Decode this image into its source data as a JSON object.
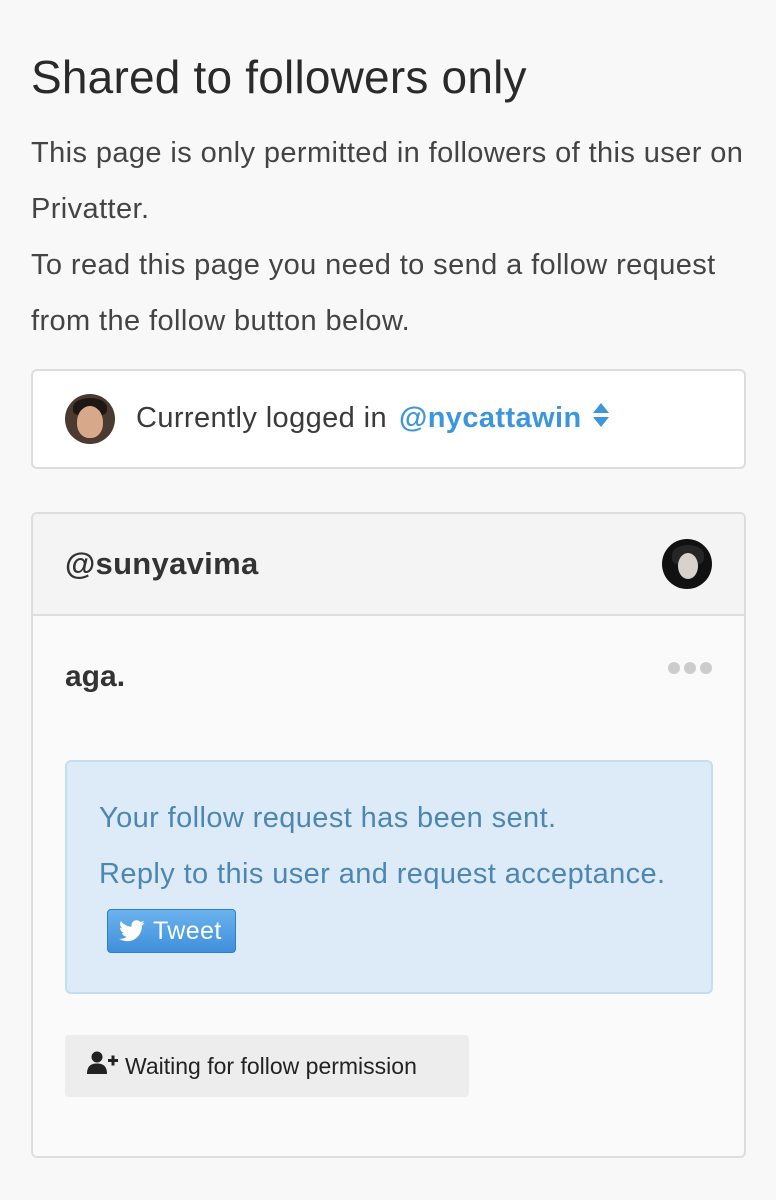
{
  "page": {
    "title": "Shared to followers only",
    "intro_line1": "This page is only permitted in followers of this user on Privatter.",
    "intro_line2": "To read this page you need to send a follow request from the follow button below."
  },
  "login": {
    "label": "Currently logged in",
    "username": "@nycattawin",
    "switch_icon": "sort-updown-icon"
  },
  "card": {
    "owner_handle": "@sunyavima",
    "post_title": "aga.",
    "more_icon": "more-dots-icon",
    "alert_line1": "Your follow request has been sent.",
    "alert_line2": "Reply to this user and request acceptance.",
    "tweet_label": "Tweet",
    "waiting_label": "Waiting for follow permission",
    "waiting_icon": "user-plus-icon",
    "footer_icon": "twitter-bird-icon"
  },
  "colors": {
    "accent": "#3d96dc",
    "alert_bg": "#dcebf7",
    "alert_text": "#4d87b1",
    "twitter_blue": "#55acee"
  }
}
